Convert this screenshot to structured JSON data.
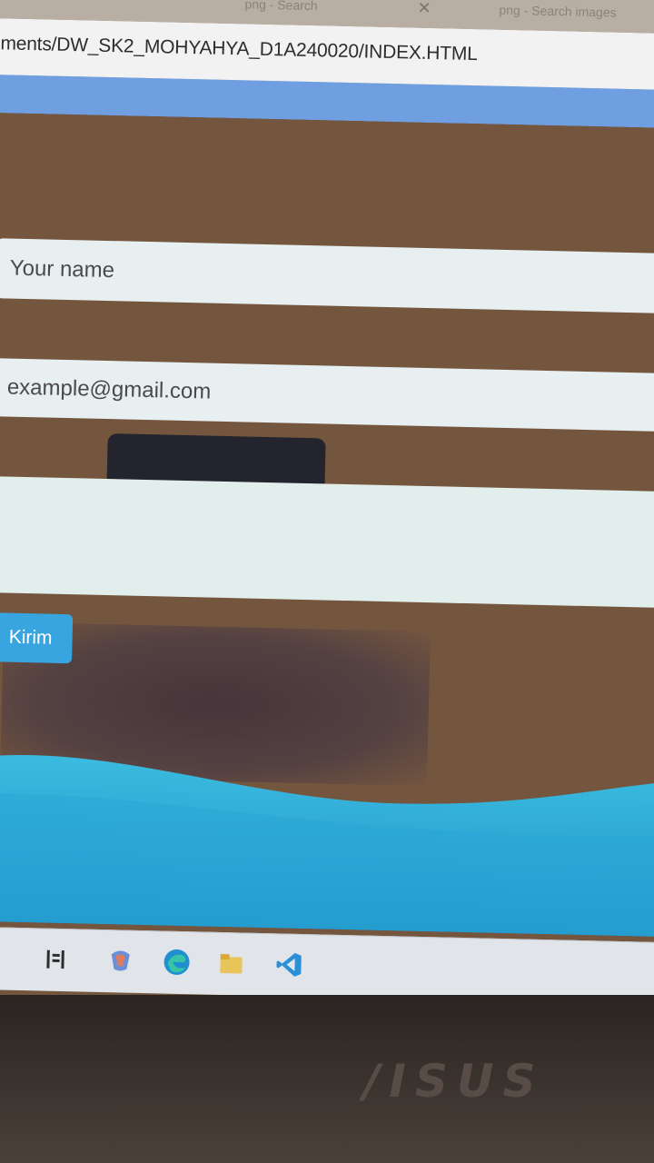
{
  "browser": {
    "tabs": [
      {
        "label": "png - Search"
      },
      {
        "label": "png - Search images"
      }
    ],
    "url": "ments/DW_SK2_MOHYAHYA_D1A240020/INDEX.HTML"
  },
  "form": {
    "name_placeholder": "Your name",
    "email_placeholder": "example@gmail.com",
    "message_placeholder": "",
    "submit_label": "Kirim"
  },
  "taskbar": {
    "icons": [
      "task-view-icon",
      "copilot-icon",
      "edge-icon",
      "file-explorer-icon",
      "vscode-icon"
    ]
  },
  "laptop": {
    "brand": "/ISUS"
  },
  "colors": {
    "page_background": "#74563f",
    "nav_bar": "#6f9fe0",
    "field_background": "#e7eff1",
    "button": "#39a5e0",
    "wave": "#2fb0d8"
  }
}
